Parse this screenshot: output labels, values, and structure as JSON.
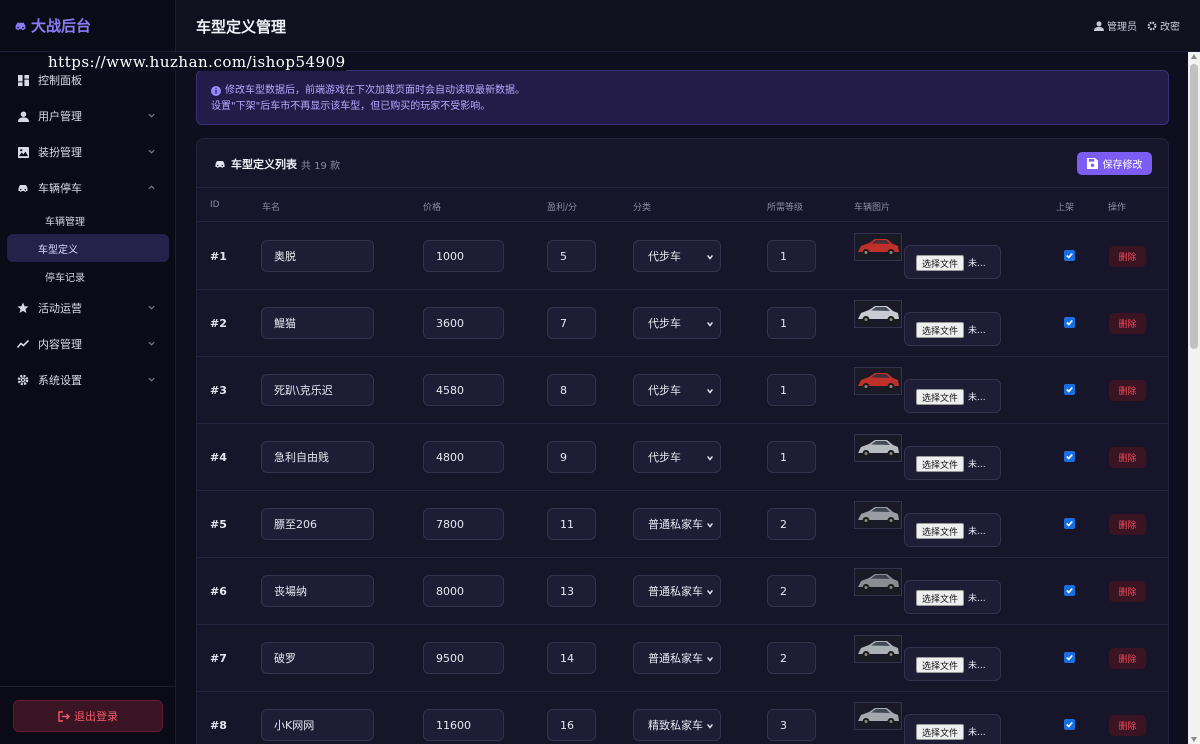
{
  "app": {
    "brand": "大战后台",
    "watermark": "https://www.huzhan.com/ishop54909"
  },
  "sidebar": {
    "items": [
      {
        "label": "控制面板",
        "icon": "dashboard-icon"
      },
      {
        "label": "用户管理",
        "icon": "user-icon"
      },
      {
        "label": "装扮管理",
        "icon": "image-icon"
      },
      {
        "label": "车辆停车",
        "icon": "car-icon"
      },
      {
        "label": "活动运营",
        "icon": "star-icon"
      },
      {
        "label": "内容管理",
        "icon": "chart-line-icon"
      },
      {
        "label": "系统设置",
        "icon": "gear-icon"
      }
    ],
    "sub_items": [
      "车辆管理",
      "车型定义",
      "停车记录"
    ],
    "logout": "退出登录"
  },
  "header": {
    "title": "车型定义管理",
    "user": "管理员",
    "settings": "改密"
  },
  "notice": {
    "line1": "修改车型数据后，前端游戏在下次加载页面时会自动读取最新数据。",
    "line2": "设置\"下架\"后车市不再显示该车型，但已购买的玩家不受影响。"
  },
  "card": {
    "title": "车型定义列表",
    "count": "共 19 款",
    "save": "保存修改"
  },
  "table": {
    "headers": [
      "ID",
      "车名",
      "价格",
      "盈利/分",
      "分类",
      "所需等级",
      "车辆图片",
      "上架",
      "操作"
    ],
    "file_button": "选择文件",
    "file_text": "未...",
    "delete_label": "删除",
    "rows": [
      {
        "id": "#1",
        "name": "奥脱",
        "price": "1000",
        "profit": "5",
        "category": "代步车",
        "level": "1",
        "car_color": "#c0302a",
        "listed": true
      },
      {
        "id": "#2",
        "name": "鯷猫",
        "price": "3600",
        "profit": "7",
        "category": "代步车",
        "level": "1",
        "car_color": "#c8ccd2",
        "listed": true
      },
      {
        "id": "#3",
        "name": "死趴\\克乐迟",
        "price": "4580",
        "profit": "8",
        "category": "代步车",
        "level": "1",
        "car_color": "#c0302a",
        "listed": true
      },
      {
        "id": "#4",
        "name": "急利自由贱",
        "price": "4800",
        "profit": "9",
        "category": "代步车",
        "level": "1",
        "car_color": "#b8bcc2",
        "listed": true
      },
      {
        "id": "#5",
        "name": "膘至206",
        "price": "7800",
        "profit": "11",
        "category": "普通私家车",
        "level": "2",
        "car_color": "#9a9ea4",
        "listed": true
      },
      {
        "id": "#6",
        "name": "丧場纳",
        "price": "8000",
        "profit": "13",
        "category": "普通私家车",
        "level": "2",
        "car_color": "#8a8e94",
        "listed": true
      },
      {
        "id": "#7",
        "name": "破罗",
        "price": "9500",
        "profit": "14",
        "category": "普通私家车",
        "level": "2",
        "car_color": "#aab0b6",
        "listed": true
      },
      {
        "id": "#8",
        "name": "小K网网",
        "price": "11600",
        "profit": "16",
        "category": "精致私家车",
        "level": "3",
        "car_color": "#a4a8ae",
        "listed": true
      }
    ]
  },
  "colors": {
    "accent": "#7c5cf2",
    "danger": "#ef4a5b",
    "bg": "#0f0e1f"
  }
}
